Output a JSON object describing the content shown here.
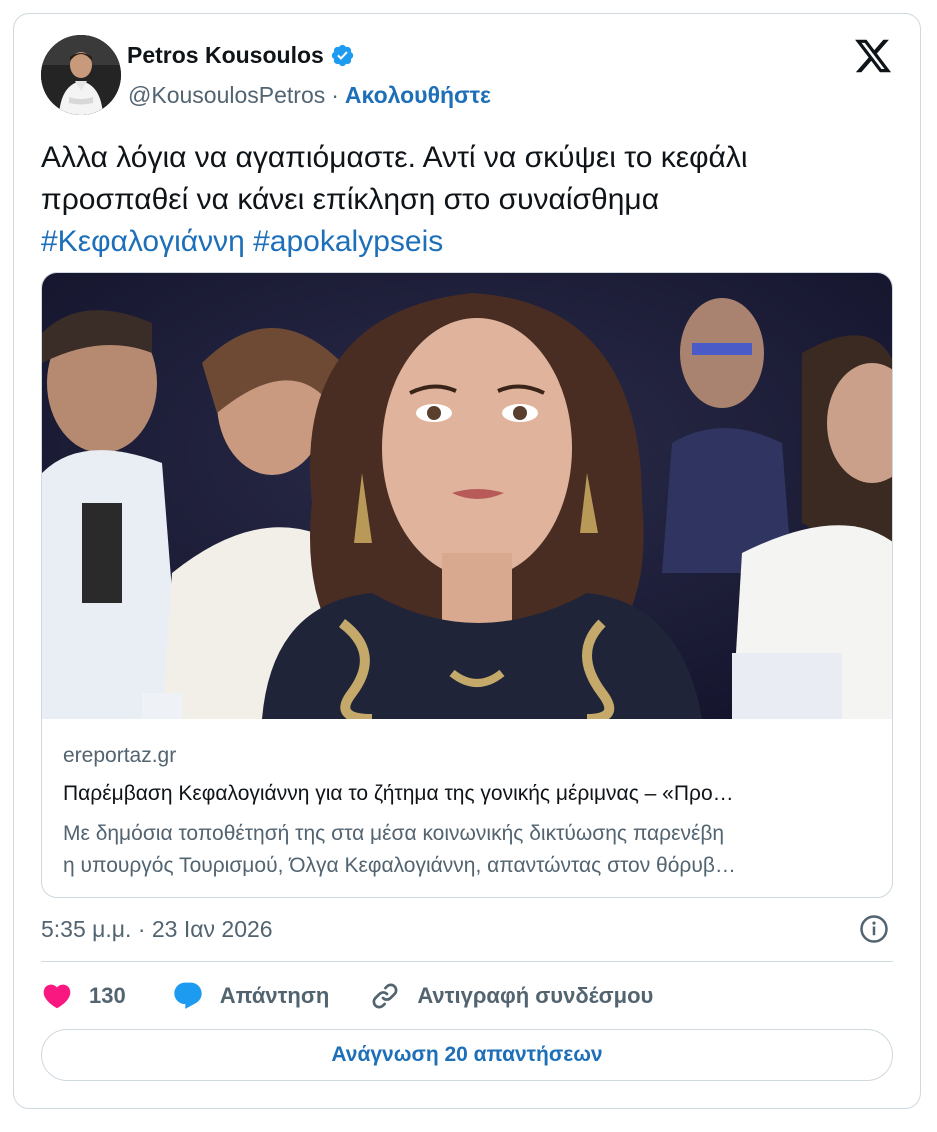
{
  "author": {
    "display_name": "Petros Kousoulos",
    "handle": "@KousoulosPetros",
    "separator": "·",
    "follow_label": "Ακολουθήστε",
    "verified_icon": "verified-badge-icon",
    "verified_color": "#1d9bf0"
  },
  "platform_icon": "x-logo-icon",
  "tweet": {
    "line1": "Αλλα λόγια να αγαπιόμαστε. Αντί να σκύψει το κεφάλι",
    "line2": "προσπαθεί να κάνει επίκληση στο συναίσθημα",
    "hashtags": "#Κεφαλογιάννη #apokalypseis"
  },
  "link_card": {
    "domain": "ereportaz.gr",
    "title": "Παρέμβαση Κεφαλογιάννη για το ζήτημα της γονικής μέριμνας – «Προ…",
    "description_line1": "Με δημόσια τοποθέτησή της στα μέσα κοινωνικής δικτύωσης παρενέβη",
    "description_line2": "η υπουργός Τουρισμού, Όλγα Κεφαλογιάννη, απαντώντας στον θόρυβ…"
  },
  "meta": {
    "timestamp": "5:35 μ.μ. · 23 Ιαν 2026",
    "info_icon": "info-icon"
  },
  "actions": {
    "like_count": "130",
    "reply_label": "Απάντηση",
    "copy_link_label": "Αντιγραφή συνδέσμου"
  },
  "read_replies_label": "Ανάγνωση 20 απαντήσεων",
  "colors": {
    "accent": "#1d6fb8",
    "like": "#f91880",
    "reply": "#1d9bf0",
    "muted": "#536471",
    "border": "#cfd9de"
  }
}
